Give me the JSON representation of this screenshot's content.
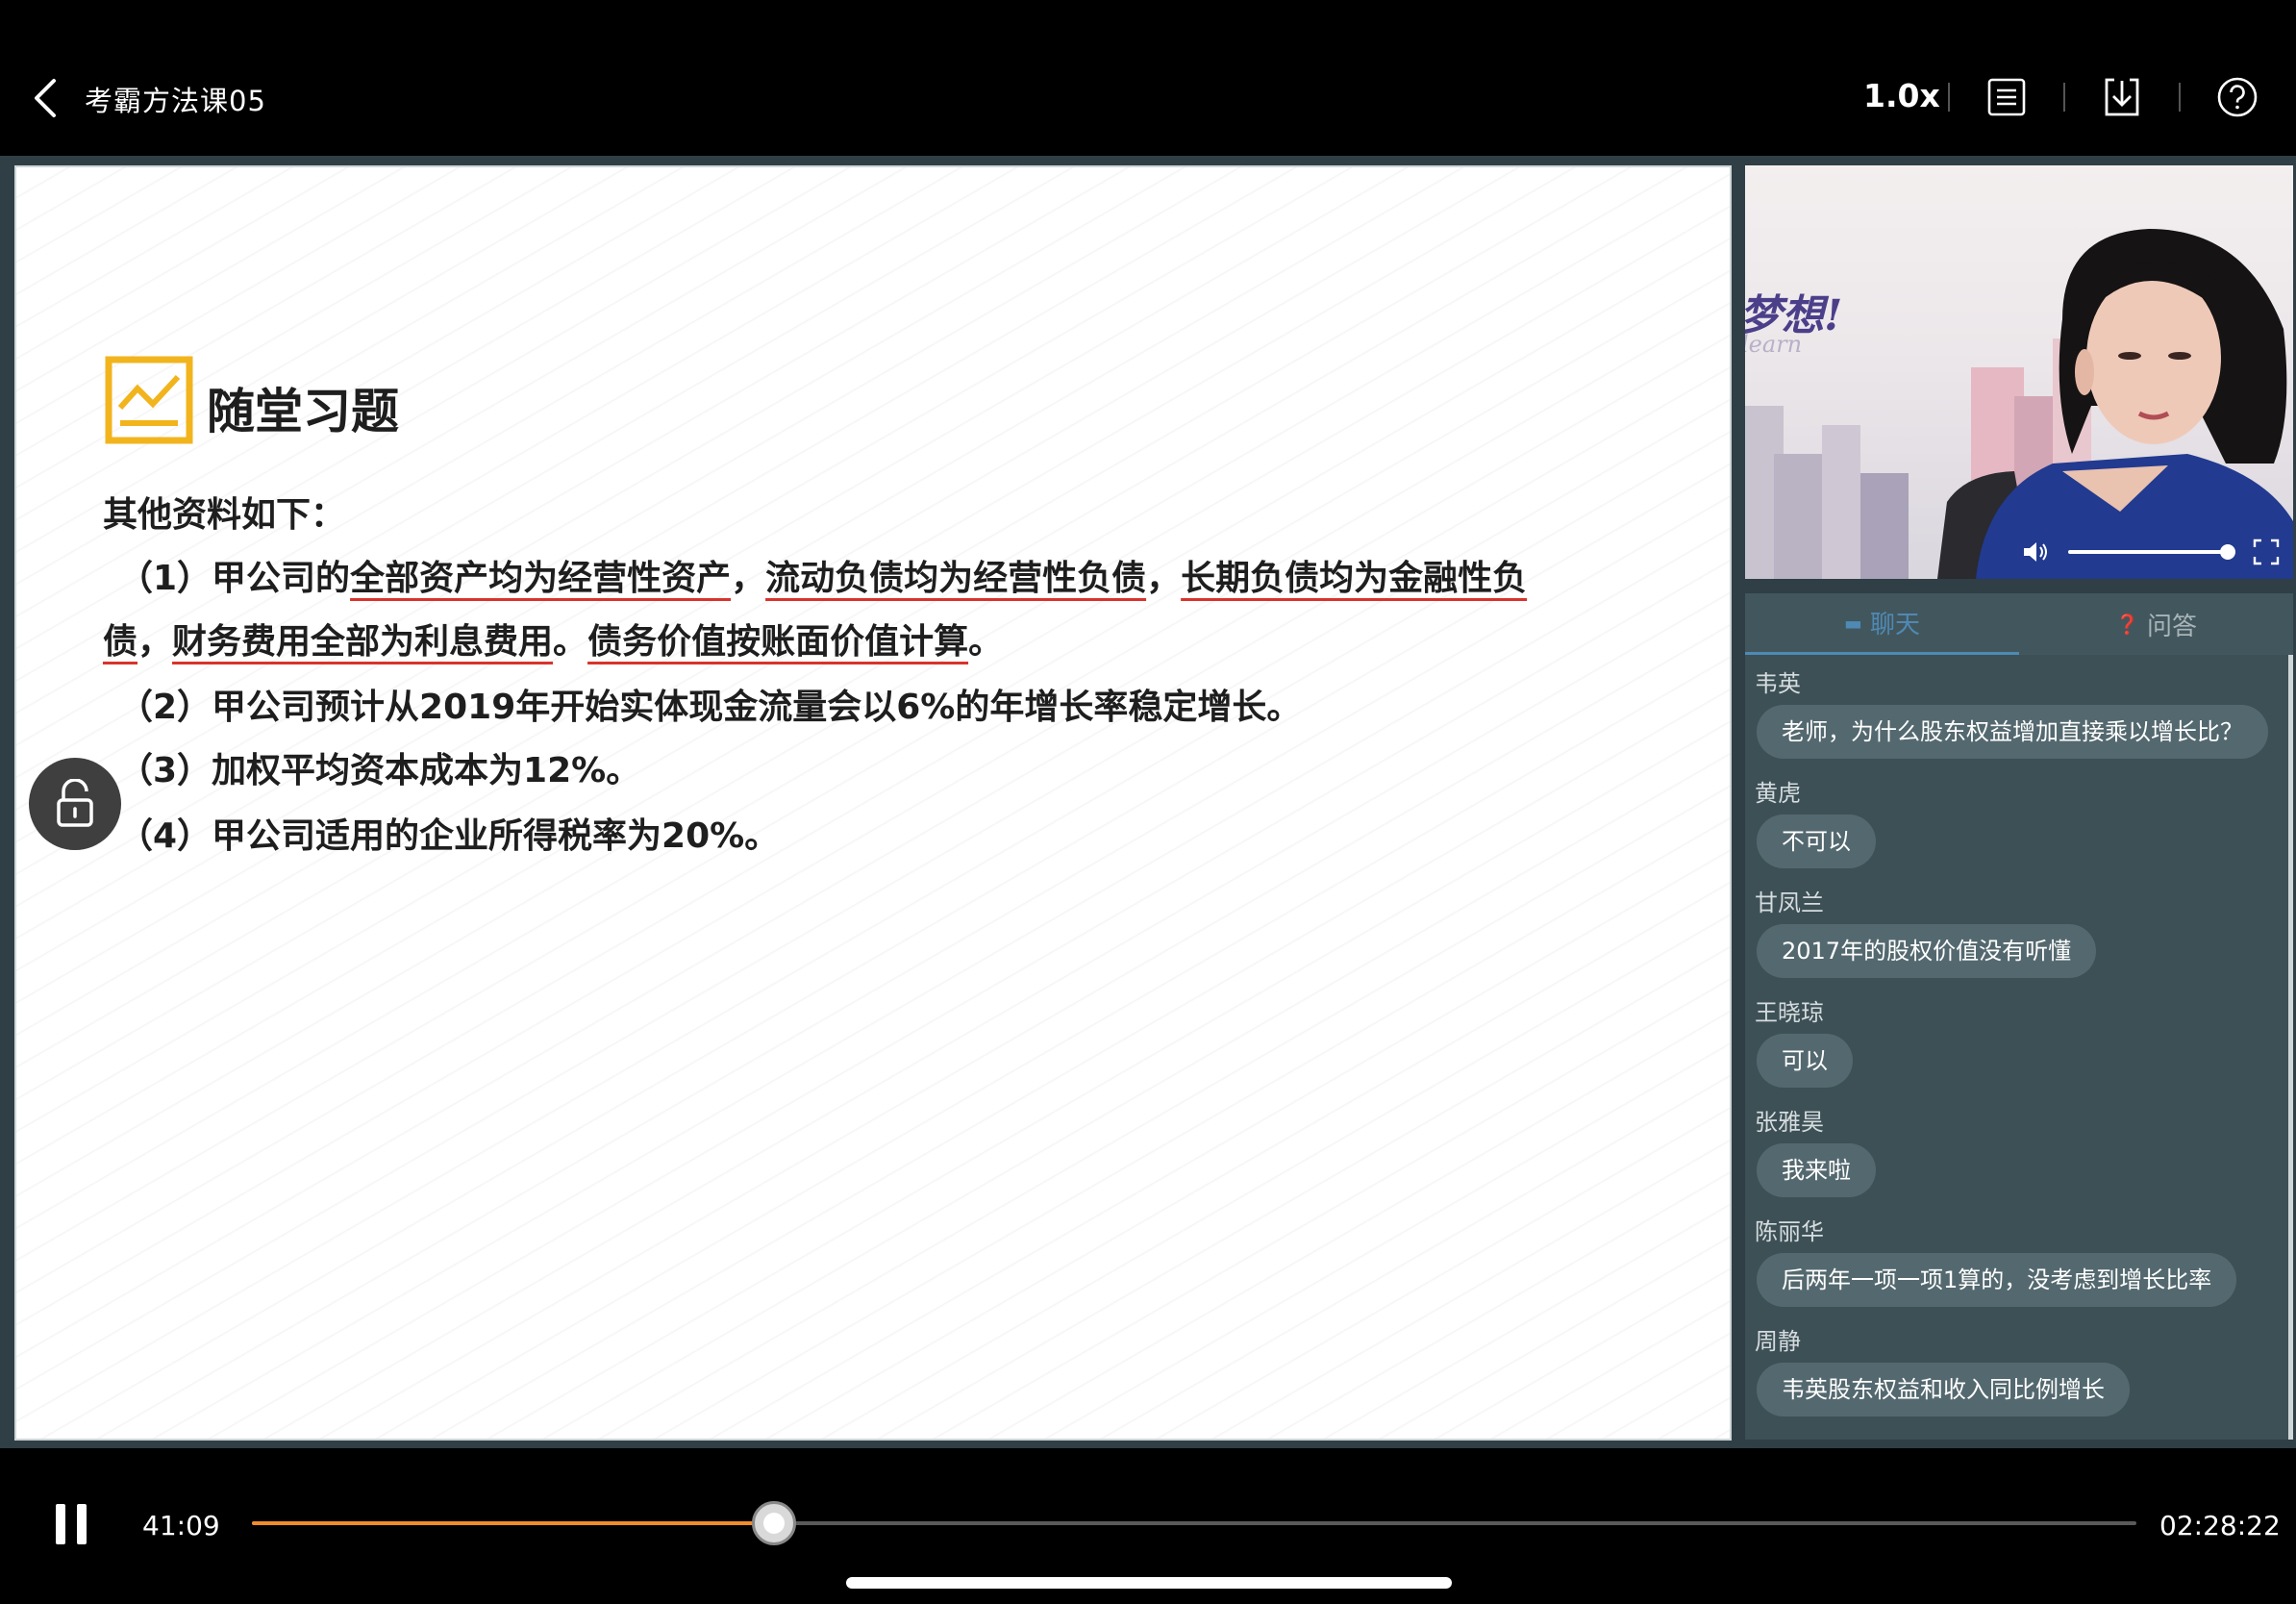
{
  "header": {
    "title": "考霸方法课05",
    "speed": "1.0x",
    "icons": [
      "back-icon",
      "list-icon",
      "download-icon",
      "help-icon"
    ]
  },
  "slide": {
    "title": "随堂习题",
    "lines": [
      "其他资料如下：",
      "（1）甲公司的全部资产均为经营性资产，流动负债均为经营性负债，长期负债均为金融性负",
      "债，财务费用全部为利息费用。债务价值按账面价值计算。",
      "（2）甲公司预计从2019年开始实体现金流量会以6%的年增长率稳定增长。",
      "（3）加权平均资本成本为12%。",
      "（4）甲公司适用的企业所得税率为20%。"
    ]
  },
  "video": {
    "poster_text": "梦想!",
    "poster_sub": "learn"
  },
  "chat": {
    "tabs": [
      {
        "label": "聊天",
        "icon": "chat-icon",
        "active": true
      },
      {
        "label": "问答",
        "icon": "qa-icon",
        "active": false
      }
    ],
    "messages": [
      {
        "name": "韦英",
        "text": "老师，为什么股东权益增加直接乘以增长比？"
      },
      {
        "name": "黄虎",
        "text": "不可以"
      },
      {
        "name": "甘凤兰",
        "text": "2017年的股权价值没有听懂"
      },
      {
        "name": "王晓琼",
        "text": "可以"
      },
      {
        "name": "张雅昊",
        "text": "我来啦"
      },
      {
        "name": "陈丽华",
        "text": "后两年一项一项1算的，没考虑到增长比率"
      },
      {
        "name": "周静",
        "text": "韦英股东权益和收入同比例增长"
      }
    ]
  },
  "player": {
    "current_time": "41:09",
    "total_time": "02:28:22",
    "progress": 0.277,
    "accent": "#f28c2b"
  }
}
